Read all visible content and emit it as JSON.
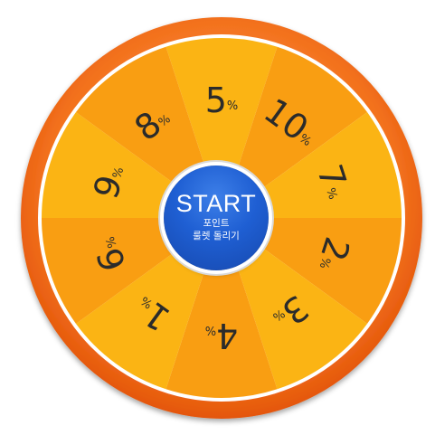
{
  "wheel": {
    "segments": [
      {
        "value": "5",
        "unit": "%"
      },
      {
        "value": "10",
        "unit": "%"
      },
      {
        "value": "7",
        "unit": "%"
      },
      {
        "value": "2",
        "unit": "%"
      },
      {
        "value": "3",
        "unit": "%"
      },
      {
        "value": "4",
        "unit": "%"
      },
      {
        "value": "1",
        "unit": "%"
      },
      {
        "value": "6",
        "unit": "%"
      },
      {
        "value": "9",
        "unit": "%"
      },
      {
        "value": "8",
        "unit": "%"
      }
    ],
    "colors": {
      "rim_light": "#ff8a3a",
      "rim_dark": "#e85a0c",
      "rim_inner": "#ffffff",
      "segment_light": "#fbb414",
      "segment_dark": "#f99e12",
      "label": "#2b2b2b"
    }
  },
  "start_button": {
    "title": "START",
    "subtitle_line1": "포인트",
    "subtitle_line2": "룰렛 돌리기",
    "color": "#1f5fd3"
  }
}
